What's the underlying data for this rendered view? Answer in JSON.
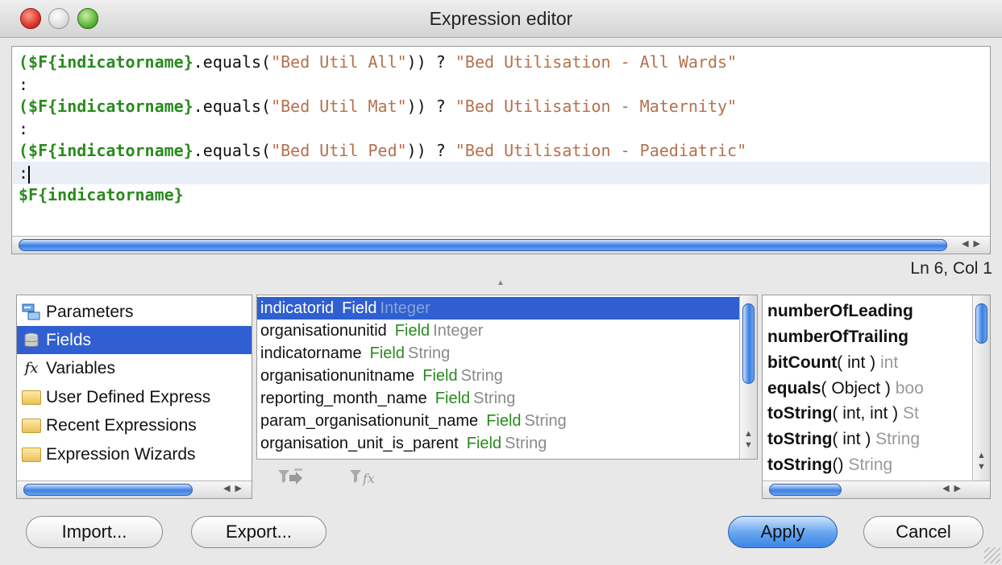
{
  "window": {
    "title": "Expression editor"
  },
  "editor": {
    "lines": [
      {
        "field": "($F{indicatorname}",
        "mid": ".equals(",
        "str1": "\"Bed Util All\"",
        "mid2": ")) ? ",
        "str2": "\"Bed Utilisation - All Wards\""
      },
      {
        "text": ":"
      },
      {
        "field": "($F{indicatorname}",
        "mid": ".equals(",
        "str1": "\"Bed Util Mat\"",
        "mid2": ")) ? ",
        "str2": "\"Bed Utilisation - Maternity\""
      },
      {
        "text": ":"
      },
      {
        "field": "($F{indicatorname}",
        "mid": ".equals(",
        "str1": "\"Bed Util Ped\"",
        "mid2": ")) ? ",
        "str2": "\"Bed Utilisation - Paediatric\""
      },
      {
        "text": ":"
      },
      {
        "field": "$F{indicatorname}"
      }
    ],
    "status": "Ln 6, Col 1"
  },
  "categories": [
    {
      "label": "Parameters",
      "icon": "parameters-icon"
    },
    {
      "label": "Fields",
      "icon": "fields-icon",
      "selected": true
    },
    {
      "label": "Variables",
      "icon": "fx-icon"
    },
    {
      "label": "User Defined Express",
      "icon": "folder-icon"
    },
    {
      "label": "Recent Expressions",
      "icon": "folder-icon"
    },
    {
      "label": "Expression Wizards",
      "icon": "folder-icon"
    }
  ],
  "fields": [
    {
      "name": "indicatorid",
      "kind": "Field",
      "type": "Integer",
      "selected": true
    },
    {
      "name": "organisationunitid",
      "kind": "Field",
      "type": "Integer"
    },
    {
      "name": "indicatorname",
      "kind": "Field",
      "type": "String"
    },
    {
      "name": "organisationunitname",
      "kind": "Field",
      "type": "String"
    },
    {
      "name": "reporting_month_name",
      "kind": "Field",
      "type": "String"
    },
    {
      "name": "param_organisationunit_name",
      "kind": "Field",
      "type": "String"
    },
    {
      "name": "organisation_unit_is_parent",
      "kind": "Field",
      "type": "String"
    }
  ],
  "methods": [
    {
      "name": "numberOfLeading",
      "sig": "",
      "ret": ""
    },
    {
      "name": "numberOfTrailing",
      "sig": "",
      "ret": ""
    },
    {
      "name": "bitCount",
      "sig": "( int )",
      "ret": "int"
    },
    {
      "name": "equals",
      "sig": "( Object )",
      "ret": "boo"
    },
    {
      "name": "toString",
      "sig": "( int, int )",
      "ret": "St"
    },
    {
      "name": "toString",
      "sig": "( int )",
      "ret": "String"
    },
    {
      "name": "toString",
      "sig": "()",
      "ret": "String"
    }
  ],
  "buttons": {
    "import": "Import...",
    "export": "Export...",
    "apply": "Apply",
    "cancel": "Cancel"
  }
}
